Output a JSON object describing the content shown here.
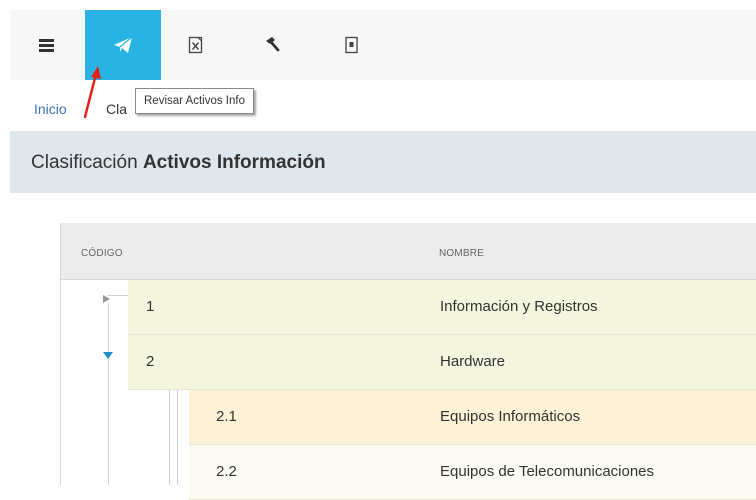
{
  "toolbar": {
    "buttons": [
      {
        "name": "menu",
        "icon": "hamburger-icon"
      },
      {
        "name": "send",
        "icon": "paper-plane-icon",
        "active": true
      },
      {
        "name": "excel-export",
        "icon": "excel-file-icon"
      },
      {
        "name": "tools",
        "icon": "hammer-icon"
      },
      {
        "name": "document",
        "icon": "document-icon"
      }
    ],
    "active_color": "#29b3e2"
  },
  "tooltip": "Revisar Activos Info",
  "breadcrumb": {
    "home": "Inicio",
    "current": "Cla"
  },
  "page": {
    "title_prefix": "Clasificación",
    "title_bold": "Activos Información"
  },
  "table": {
    "headers": {
      "code": "CÓDIGO",
      "name": "NOMBRE"
    },
    "rows": [
      {
        "code": "1",
        "name": "Información y Registros",
        "level": 1,
        "expanded": false
      },
      {
        "code": "2",
        "name": "Hardware",
        "level": 1,
        "expanded": true
      },
      {
        "code": "2.1",
        "name": "Equipos Informáticos",
        "level": 2,
        "highlighted": true
      },
      {
        "code": "2.2",
        "name": "Equipos de Telecomunicaciones",
        "level": 2
      }
    ]
  },
  "colors": {
    "level1_row": "#f5f6e0",
    "highlighted_row": "#fdf1d6",
    "title_bar": "#dfe6ec",
    "link": "#3d74b7",
    "annotation_arrow": "#e0201b"
  }
}
